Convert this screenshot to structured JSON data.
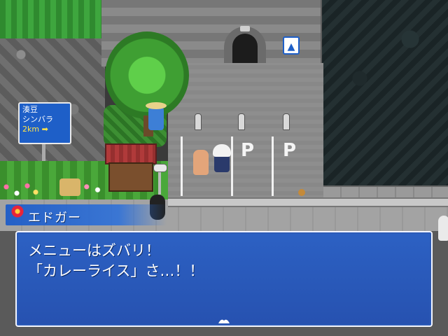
{
  "road_sign": {
    "line1": "湊豆",
    "line2": "シンバラ",
    "line3": "2km ➡"
  },
  "parking": {
    "mark_1": "P",
    "mark_2": "P"
  },
  "info_sign": {
    "icon": "bus-icon"
  },
  "dialog": {
    "speaker": "エドガー",
    "lines": [
      "メニューはズバリ！",
      "「カレーライス」さ…！！"
    ],
    "advance_icon": "wing-cursor-icon"
  },
  "colors": {
    "dialog_blue": "#2662d2",
    "dialog_border": "#f3f6ff",
    "sign_blue": "#1e5fc8"
  }
}
